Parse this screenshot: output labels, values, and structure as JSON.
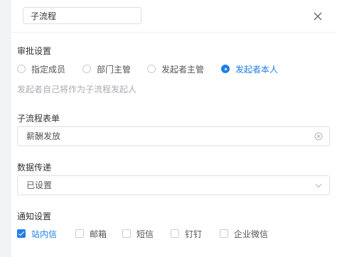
{
  "title_input": {
    "value": "子流程"
  },
  "approval": {
    "label": "审批设置",
    "options": [
      "指定成员",
      "部门主管",
      "发起者主管",
      "发起者本人"
    ],
    "selected": "发起者本人",
    "hint": "发起者自己将作为子流程发起人"
  },
  "form": {
    "label": "子流程表单",
    "value": "薪酬发放"
  },
  "data_pass": {
    "label": "数据传递",
    "value": "已设置"
  },
  "notify": {
    "label": "通知设置",
    "options": [
      "站内信",
      "邮箱",
      "短信",
      "钉钉",
      "企业微信"
    ],
    "checked": [
      "站内信"
    ]
  },
  "colors": {
    "accent": "#1f7ee9",
    "hint": "#a8abb2",
    "border": "#dcdfe6"
  }
}
